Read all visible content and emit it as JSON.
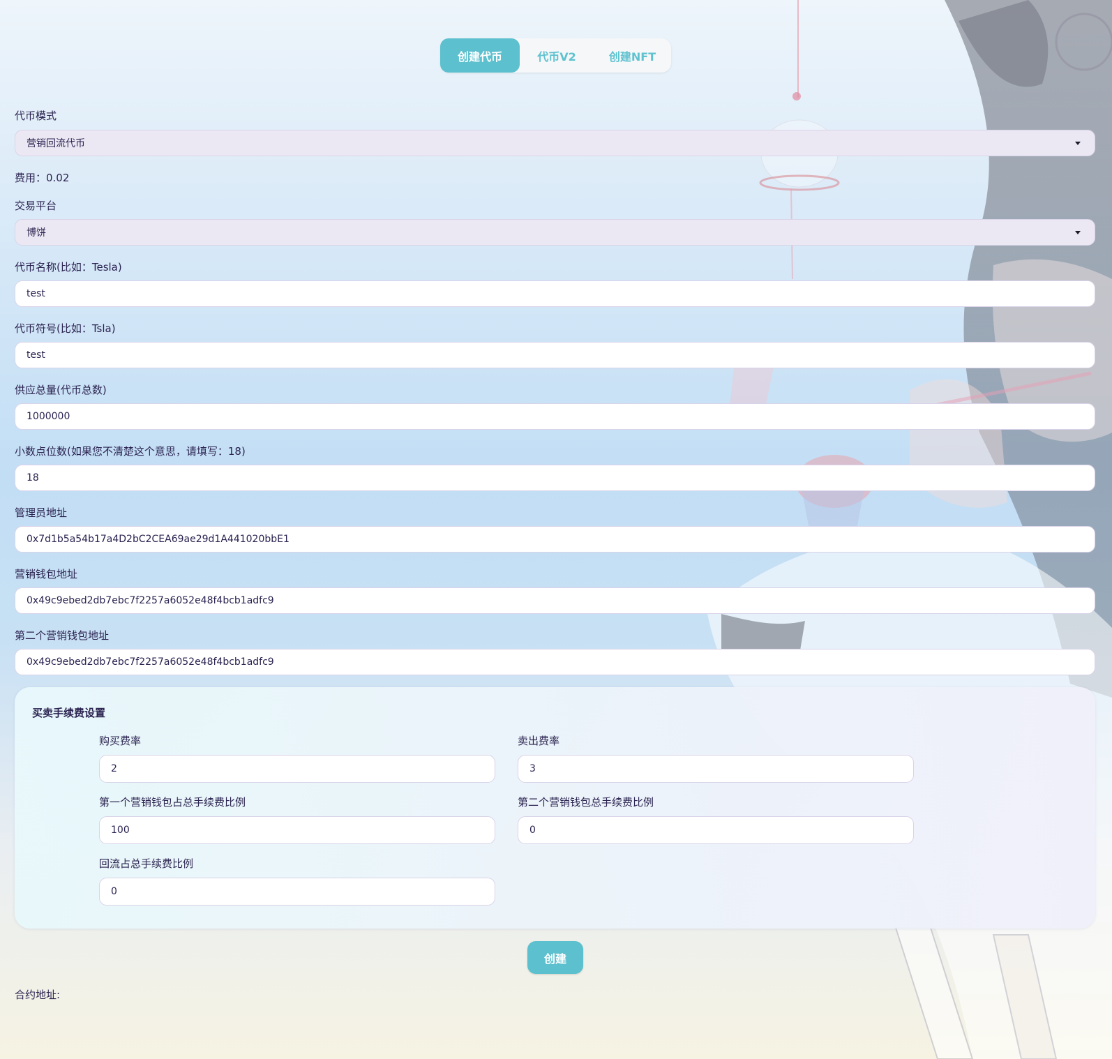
{
  "tabs": [
    {
      "label": "创建代币"
    },
    {
      "label": "代币V2"
    },
    {
      "label": "创建NFT"
    }
  ],
  "form": {
    "mode_label": "代币模式",
    "mode_value": "营销回流代币",
    "fee_text": "费用：0.02",
    "platform_label": "交易平台",
    "platform_value": "博饼",
    "name_label": "代币名称(比如：Tesla)",
    "name_value": "test",
    "symbol_label": "代币符号(比如：Tsla)",
    "symbol_value": "test",
    "supply_label": "供应总量(代币总数)",
    "supply_value": "1000000",
    "decimals_label": "小数点位数(如果您不清楚这个意思，请填写：18)",
    "decimals_value": "18",
    "admin_label": "管理员地址",
    "admin_value": "0x7d1b5a54b17a4D2bC2CEA69ae29d1A441020bbE1",
    "marketing_label": "营销钱包地址",
    "marketing_value": "0x49c9ebed2db7ebc7f2257a6052e48f4bcb1adfc9",
    "marketing2_label": "第二个营销钱包地址",
    "marketing2_value": "0x49c9ebed2db7ebc7f2257a6052e48f4bcb1adfc9"
  },
  "fees": {
    "title": "买卖手续费设置",
    "buy_label": "购买费率",
    "buy_value": "2",
    "sell_label": "卖出费率",
    "sell_value": "3",
    "wallet1_label": "第一个营销钱包占总手续费比例",
    "wallet1_value": "100",
    "wallet2_label": "第二个营销钱包总手续费比例",
    "wallet2_value": "0",
    "reflow_label": "回流占总手续费比例",
    "reflow_value": "0"
  },
  "create_button": "创建",
  "contract_label": "合约地址:",
  "colors": {
    "accent": "#5cc0ce",
    "text": "#2b2350",
    "select_bg": "#ece8f3"
  }
}
